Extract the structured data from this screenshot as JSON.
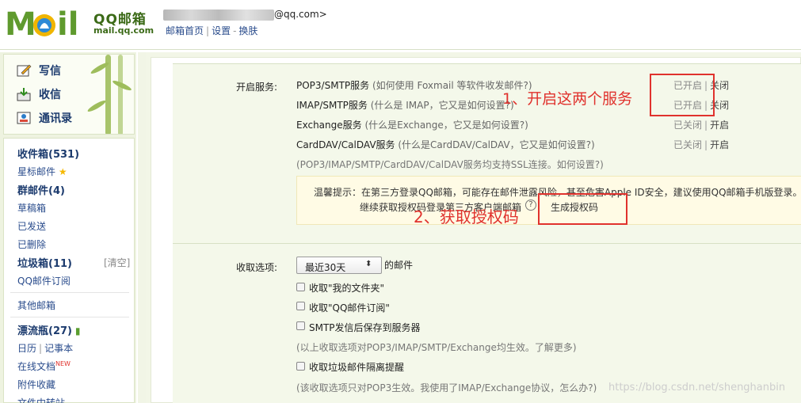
{
  "header": {
    "brand_name": "QQ邮箱",
    "brand_domain": "mail.qq.com",
    "email_domain": "@qq.com>",
    "links": [
      "邮箱首页",
      "设置",
      "换肤"
    ]
  },
  "sidebar": {
    "actions": [
      "写信",
      "收信",
      "通讯录"
    ],
    "items": [
      {
        "label": "收件箱(531)",
        "bold": true
      },
      {
        "label": "星标邮件"
      },
      {
        "label": "群邮件(4)",
        "bold": true
      },
      {
        "label": "草稿箱"
      },
      {
        "label": "已发送"
      },
      {
        "label": "已删除"
      },
      {
        "label": "垃圾箱(11)",
        "bold": true
      },
      {
        "label": "QQ邮件订阅"
      },
      {
        "label": "其他邮箱"
      },
      {
        "label": "漂流瓶(27)",
        "bold": true
      },
      {
        "label": "日历"
      },
      {
        "label": "在线文档"
      },
      {
        "label": "附件收藏"
      },
      {
        "label": "文件中转站"
      }
    ],
    "clear_link": "[清空]",
    "notepad": "记事本",
    "new_badge": "NEW"
  },
  "services": {
    "label": "开启服务:",
    "rows": [
      {
        "name": "POP3/SMTP服务",
        "hint": "(如何使用 Foxmail 等软件收发邮件?)",
        "status": "已开启",
        "action": "关闭"
      },
      {
        "name": "IMAP/SMTP服务",
        "hint": "(什么是 IMAP，它又是如何设置?)",
        "status": "已开启",
        "action": "关闭"
      },
      {
        "name": "Exchange服务",
        "hint": "(什么是Exchange，它又是如何设置?)",
        "status": "已关闭",
        "action": "开启"
      },
      {
        "name": "CardDAV/CalDAV服务",
        "hint": "(什么是CardDAV/CalDAV，它又是如何设置?)",
        "status": "已关闭",
        "action": "开启"
      }
    ],
    "ssl_note": "(POP3/IMAP/SMTP/CardDAV/CalDAV服务均支持SSL连接。如何设置?)",
    "tip_line1": "温馨提示：在第三方登录QQ邮箱，可能存在邮件泄露风险，甚至危害Apple ID安全，建议使用QQ邮箱手机版登录。",
    "tip_line2": "继续获取授权码登录第三方客户端邮箱",
    "help_icon": "?",
    "gen_code": "生成授权码"
  },
  "annotations": {
    "step1": "1、开启这两个服务",
    "step2": "2、获取授权码"
  },
  "receive": {
    "label": "收取选项:",
    "select_value": "最近30天",
    "select_suffix": "的邮件",
    "options": [
      "收取\"我的文件夹\"",
      "收取\"QQ邮件订阅\"",
      "SMTP发信后保存到服务器"
    ],
    "note1": "(以上收取选项对POP3/IMAP/SMTP/Exchange均生效。了解更多)",
    "option_spam": "收取垃圾邮件隔离提醒",
    "note2": "(该收取选项只对POP3生效。我使用了IMAP/Exchange协议，怎么办?)"
  },
  "watermark": "https://blog.csdn.net/shenghanbin",
  "colors": {
    "accent_red": "#e0322d",
    "brand_green": "#3b6a17",
    "link_blue": "#2a4c8c"
  }
}
